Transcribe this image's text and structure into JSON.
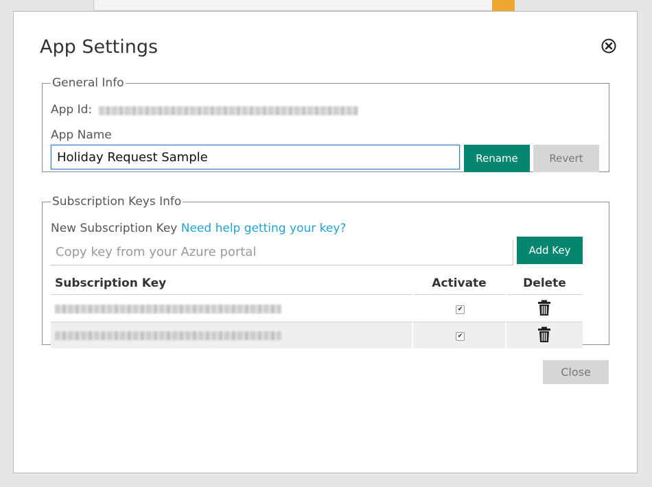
{
  "dialog": {
    "title": "App Settings",
    "close_icon": "circle-x-icon"
  },
  "general": {
    "legend": "General Info",
    "app_id_label": "App Id:",
    "app_name_label": "App Name",
    "app_name_value": "Holiday Request Sample",
    "rename_label": "Rename",
    "revert_label": "Revert"
  },
  "keys": {
    "legend": "Subscription Keys Info",
    "new_key_label": "New Subscription Key",
    "help_link": "Need help getting your key?",
    "key_placeholder": "Copy key from your Azure portal",
    "add_key_label": "Add Key",
    "columns": [
      "Subscription Key",
      "Activate",
      "Delete"
    ],
    "rows": [
      {
        "activated": true,
        "delete_icon": "trash-icon"
      },
      {
        "activated": true,
        "delete_icon": "trash-icon"
      }
    ],
    "checkmark": "✔"
  },
  "footer": {
    "close_label": "Close"
  },
  "colors": {
    "primary_button": "#07866f",
    "secondary_button": "#d6d6d6",
    "link": "#1ba5d8",
    "focus_border": "#2e7fd3"
  }
}
